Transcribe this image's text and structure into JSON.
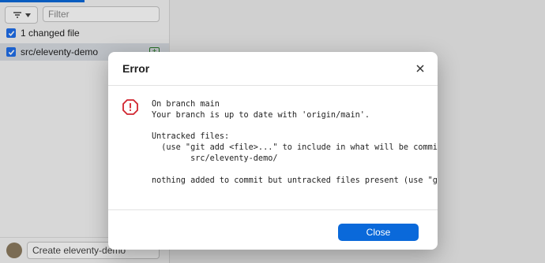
{
  "sidebar": {
    "filter_placeholder": "Filter",
    "changed_files_label": "1 changed file",
    "files": [
      {
        "path": "src/eleventy-demo",
        "status": "+"
      }
    ],
    "commit_placeholder": "Create eleventy-demo"
  },
  "dialog": {
    "title": "Error",
    "icon": "error-octagon-icon",
    "message": "On branch main\nYour branch is up to date with 'origin/main'.\n\nUntracked files:\n  (use \"git add <file>...\" to include in what will be committed)\n        src/eleventy-demo/\n\nnothing added to commit but untracked files present (use \"git add\" to track)",
    "close_button_label": "Close"
  },
  "colors": {
    "accent": "#0a69da",
    "error": "#d1242f",
    "added": "#2a7d2a"
  }
}
